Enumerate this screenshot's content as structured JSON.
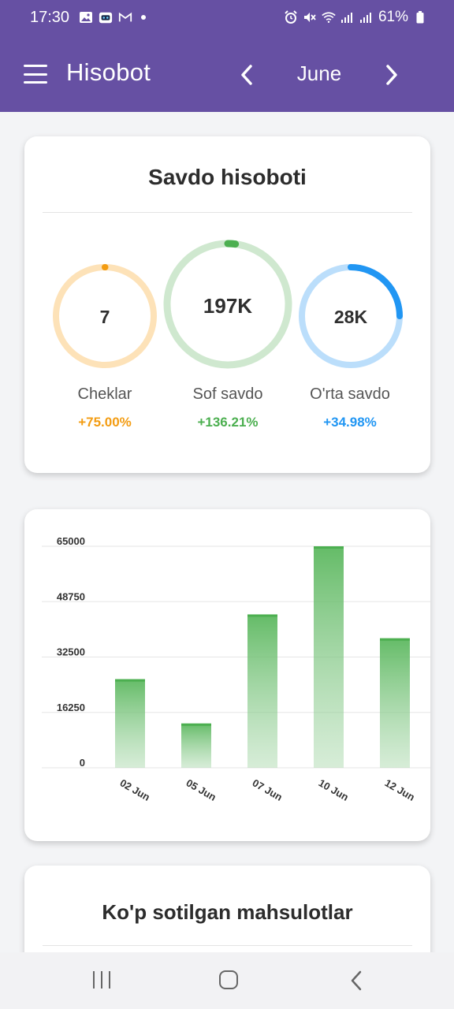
{
  "status_bar": {
    "time": "17:30",
    "battery": "61%",
    "icons": [
      "gallery-icon",
      "robot-icon",
      "gmail-icon",
      "alarm-icon",
      "mute-icon",
      "wifi-icon",
      "signal-icon",
      "battery-icon"
    ]
  },
  "app_bar": {
    "title": "Hisobot",
    "month": "June",
    "color": "#6650a3"
  },
  "sales_card": {
    "title": "Savdo hisoboti",
    "metrics": [
      {
        "value": "7",
        "label": "Cheklar",
        "change": "+75.00%",
        "color": "#f39c12",
        "track": "#fde2b8",
        "progress": 0.0
      },
      {
        "value": "197K",
        "label": "Sof savdo",
        "change": "+136.21%",
        "color": "#4caf50",
        "track": "#cfe8cf",
        "progress": 0.02
      },
      {
        "value": "28K",
        "label": "O'rta savdo",
        "change": "+34.98%",
        "color": "#2196f3",
        "track": "#bbdefb",
        "progress": 0.25
      }
    ]
  },
  "chart_data": {
    "type": "bar",
    "categories": [
      "02 Jun",
      "05 Jun",
      "07 Jun",
      "10 Jun",
      "12 Jun"
    ],
    "values": [
      26000,
      13000,
      45000,
      65000,
      38000
    ],
    "y_ticks": [
      "0",
      "16250",
      "32500",
      "48750",
      "65000"
    ],
    "ylim": [
      0,
      65000
    ],
    "bar_color": "#4caf50",
    "grid": true
  },
  "top_products_card": {
    "title": "Ko'p sotilgan mahsulotlar"
  },
  "nav_bar": {
    "icons": [
      "recents-icon",
      "home-icon",
      "back-icon"
    ]
  }
}
